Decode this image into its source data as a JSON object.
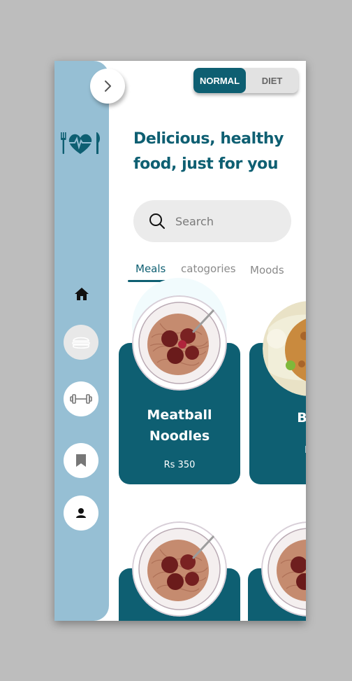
{
  "mode_toggle": {
    "normal": "NORMAL",
    "diet": "DIET",
    "selected": "NORMAL"
  },
  "headline": {
    "line1": "Delicious, healthy",
    "line2": "food, just for you"
  },
  "search": {
    "placeholder": "Search"
  },
  "tabs": [
    {
      "label": "Meals",
      "active": true
    },
    {
      "label": "catogories",
      "active": false
    },
    {
      "label": "Moods",
      "active": false
    }
  ],
  "cards": [
    {
      "title_line1": "Meatball",
      "title_line2": "Noodles",
      "price": "Rs 350"
    },
    {
      "title_line1": "Bur",
      "price": "Rs"
    }
  ],
  "sidebar": {
    "icons": [
      "home-icon",
      "burger-icon",
      "dumbbell-icon",
      "bookmark-icon",
      "user-icon"
    ],
    "logo": "heart-cutlery-logo"
  },
  "colors": {
    "primary": "#0e5f72",
    "sidebar": "#96bfd4",
    "background": "#bdbdbd",
    "search_bg": "#ebebeb"
  }
}
